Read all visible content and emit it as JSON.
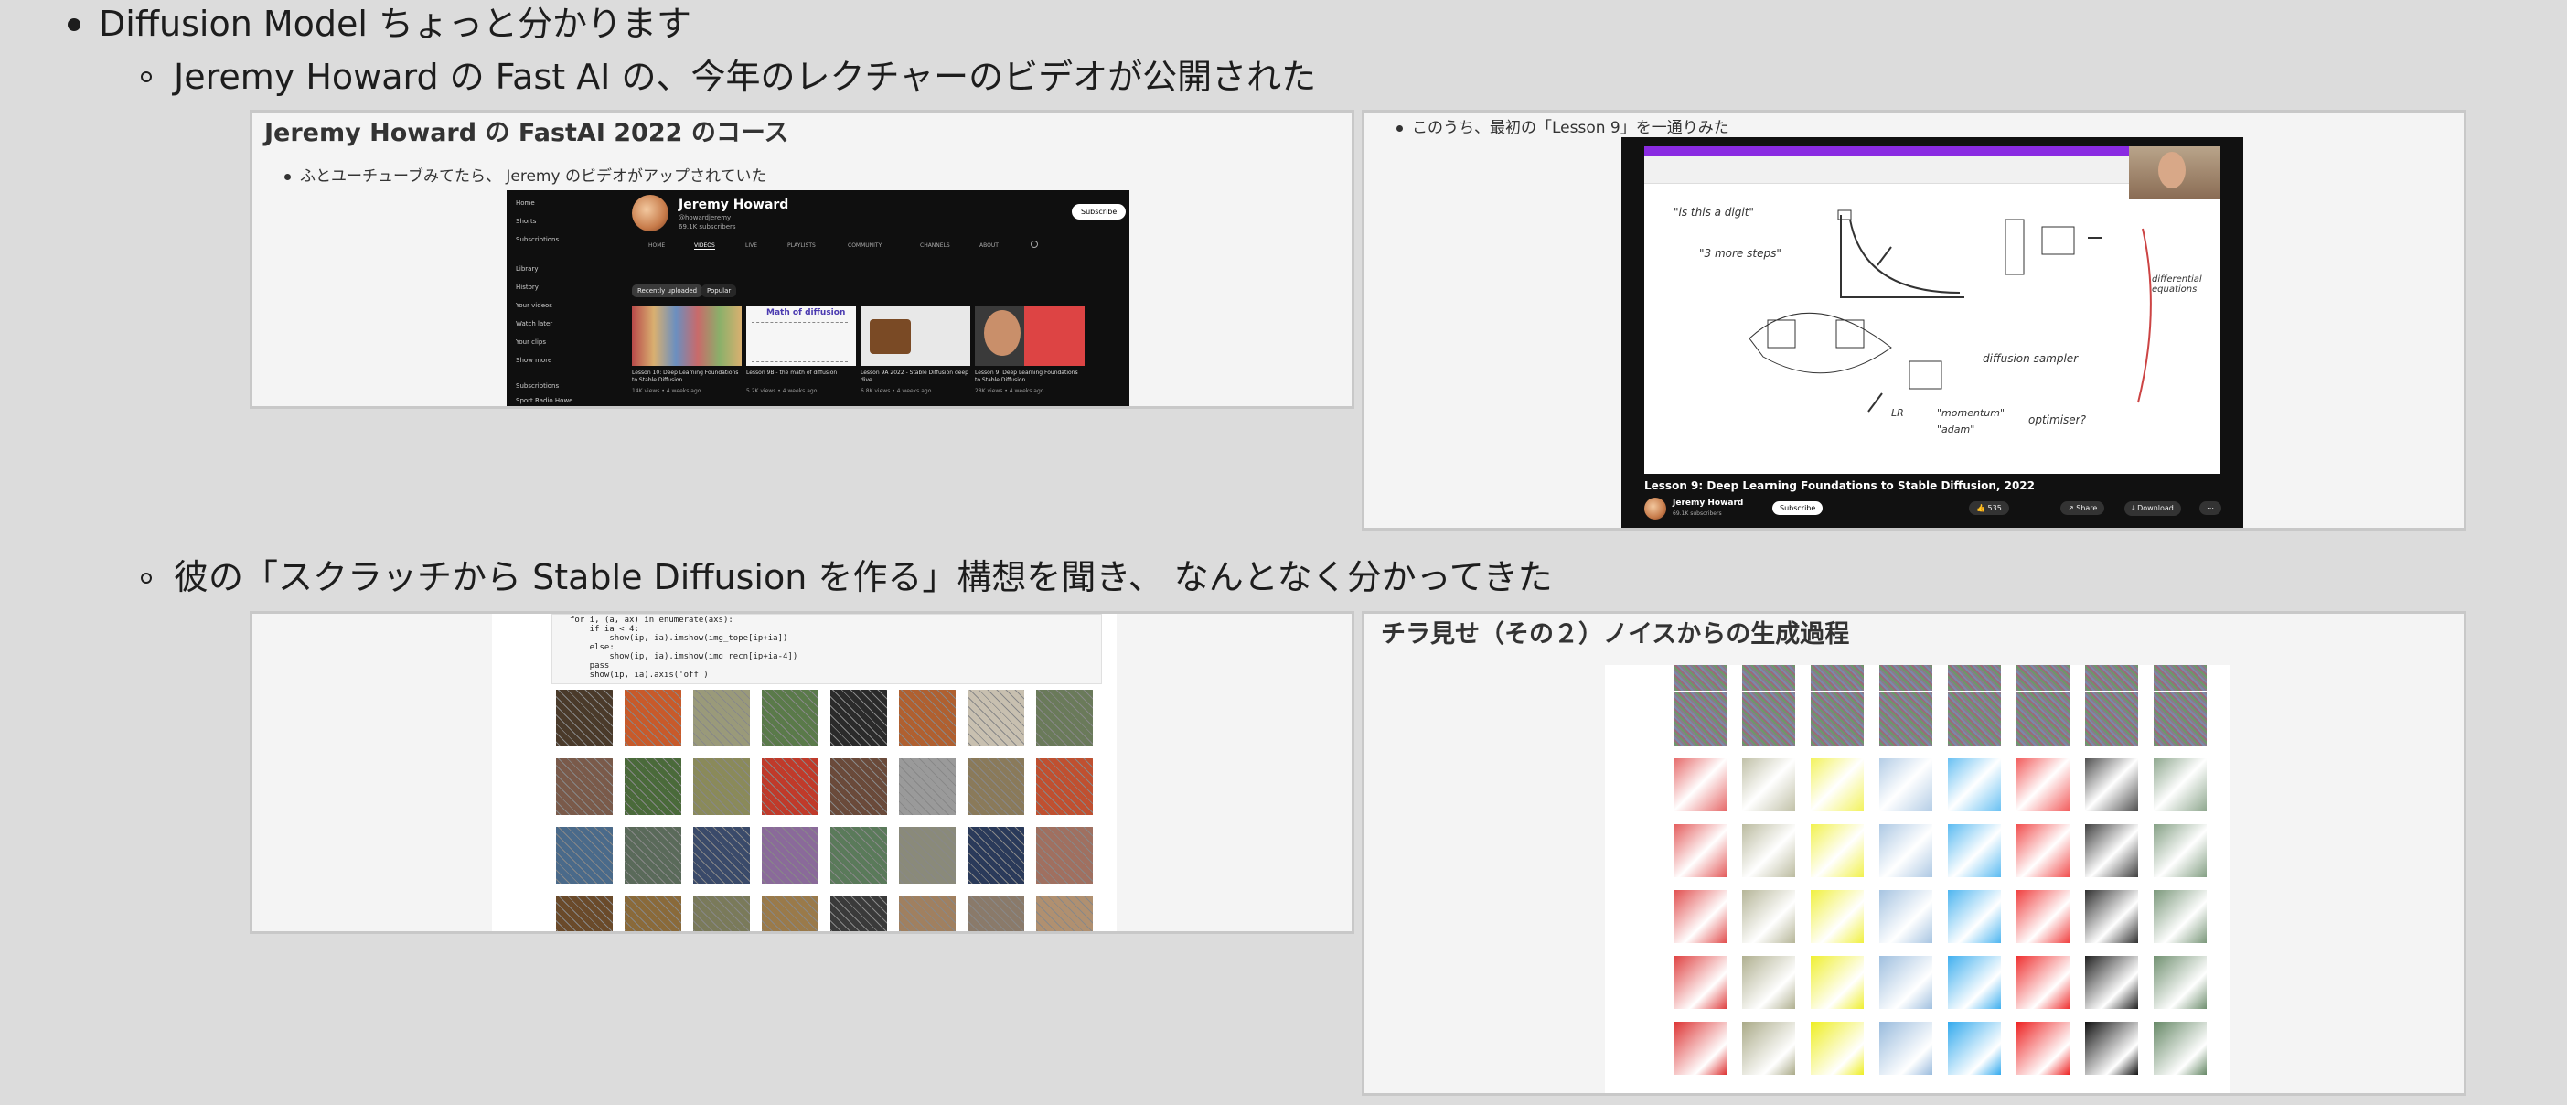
{
  "bullets": {
    "top": "Diffusion Model ちょっと分かります",
    "sub1": "Jeremy Howard の Fast AI の、今年のレクチャーのビデオが公開された",
    "sub2": "彼の「スクラッチから Stable Diffusion を作る」構想を聞き、 なんとなく分かってきた"
  },
  "slide1": {
    "title": "Jeremy Howard の FastAI 2022 のコース",
    "text": "ふとユーチューブみてたら、 Jeremy のビデオがアップされていた",
    "youtube": {
      "channel": "Jeremy Howard",
      "handle": "@howardjeremy",
      "subs": "69.1K subscribers",
      "subscribe": "Subscribe",
      "tabs": [
        "HOME",
        "VIDEOS",
        "LIVE",
        "PLAYLISTS",
        "COMMUNITY",
        "CHANNELS",
        "ABOUT"
      ],
      "sidebar": [
        "Home",
        "Shorts",
        "Subscriptions",
        "Library",
        "History",
        "Your videos",
        "Watch later",
        "Your clips",
        "Show more",
        "Subscriptions",
        "Sport Radio Howe"
      ],
      "chips": [
        "Recently uploaded",
        "Popular"
      ],
      "videos": [
        {
          "title": "Lesson 10: Deep Learning Foundations to Stable Diffusion...",
          "meta": "14K views • 4 weeks ago"
        },
        {
          "title": "Lesson 9B - the math of diffusion",
          "meta": "5.2K views • 4 weeks ago"
        },
        {
          "title": "Lesson 9A 2022 - Stable Diffusion deep dive",
          "meta": "6.8K views • 4 weeks ago"
        },
        {
          "title": "Lesson 9: Deep Learning Foundations to Stable Diffusion...",
          "meta": "28K views • 4 weeks ago"
        }
      ],
      "thumb2_label": "Math of diffusion"
    }
  },
  "slide2": {
    "text": "このうち、最初の「Lesson 9」を一通りみた",
    "video": {
      "title": "Lesson 9: Deep Learning Foundations to Stable Diffusion, 2022",
      "channel": "Jeremy Howard",
      "subs": "69.1K subscribers",
      "subscribe": "Subscribe",
      "like": "535",
      "share": "Share",
      "download": "Download",
      "more": "⋯"
    },
    "handwriting": {
      "a": "\"is this a digit\"",
      "b": "\"3 more steps\"",
      "c": "diffusion sampler",
      "d": "differential equations",
      "e": "\"momentum\"",
      "f": "\"adam\"",
      "g": "optimiser?",
      "h": "LR"
    }
  },
  "slide3": {
    "code": [
      "for i, (a, ax) in enumerate(axs):",
      "    if ia < 4:",
      "        show(ip, ia).imshow(img_tope[ip+ia])",
      "    else:",
      "        show(ip, ia).imshow(img_recn[ip+ia-4])",
      "    pass",
      "    show(ip, ia).axis('off')"
    ]
  },
  "slide4": {
    "title": "チラ見せ（その２）ノイスからの生成過程"
  },
  "colors": {
    "background": "#dcdcdc",
    "frame_border": "#c8c8c8",
    "youtube_bg": "#0f0f0f",
    "whiteboard_accent": "#8a2be2"
  }
}
